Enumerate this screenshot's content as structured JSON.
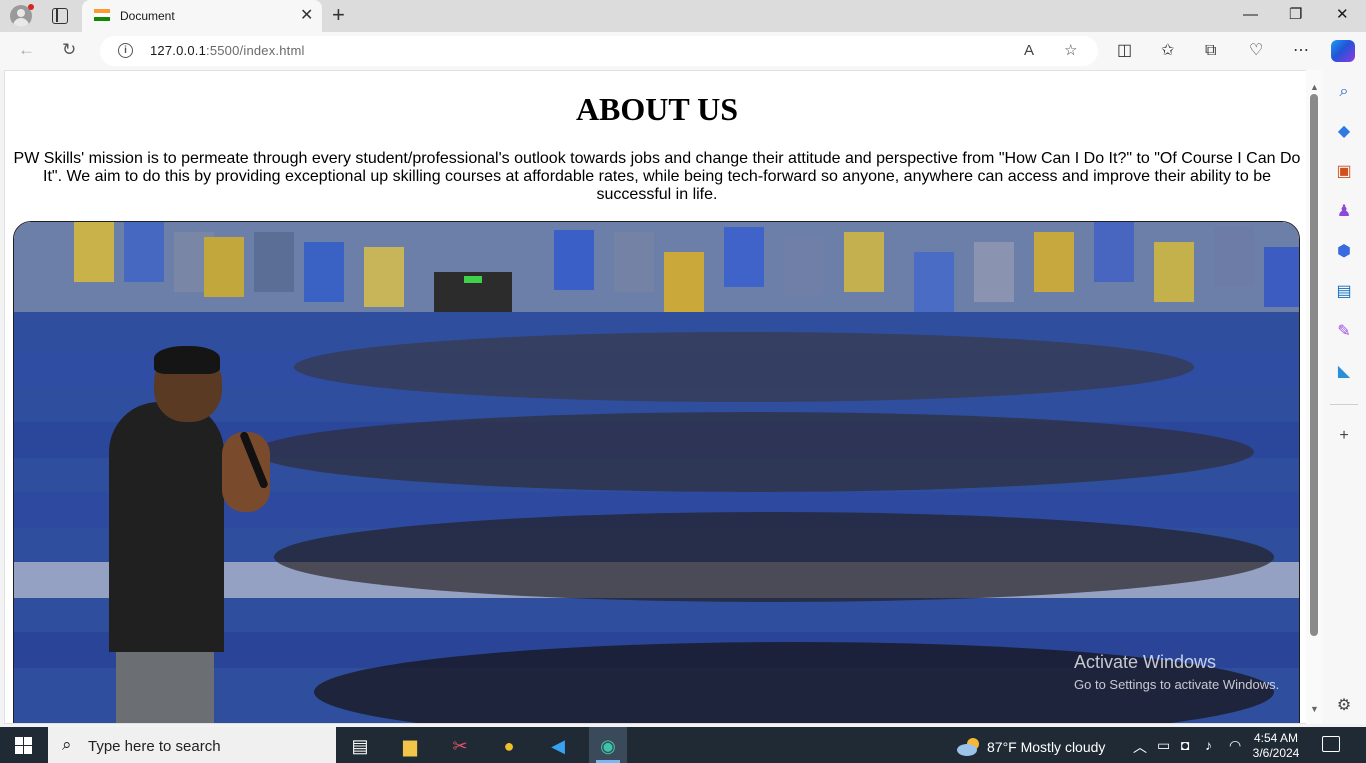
{
  "browser": {
    "tab_title": "Document",
    "url_host": "127.0.0.1",
    "url_rest": ":5500/index.html"
  },
  "page": {
    "heading": "ABOUT US",
    "paragraph": "PW Skills' mission is to permeate through every student/professional's outlook towards jobs and change their attitude and perspective from \"How Can I Do It?\" to \"Of Course I Can Do It\". We aim to do this by providing exceptional up skilling courses at affordable rates, while being tech-forward so anyone, anywhere can access and improve their ability to be successful in life."
  },
  "watermark": {
    "line1": "Activate Windows",
    "line2": "Go to Settings to activate Windows."
  },
  "taskbar": {
    "search_placeholder": "Type here to search",
    "weather": "87°F  Mostly cloudy",
    "time": "4:54 AM",
    "date": "3/6/2024"
  },
  "colors": {
    "accent_blue": "#2f4f9e",
    "taskbar": "#1f2a35"
  }
}
